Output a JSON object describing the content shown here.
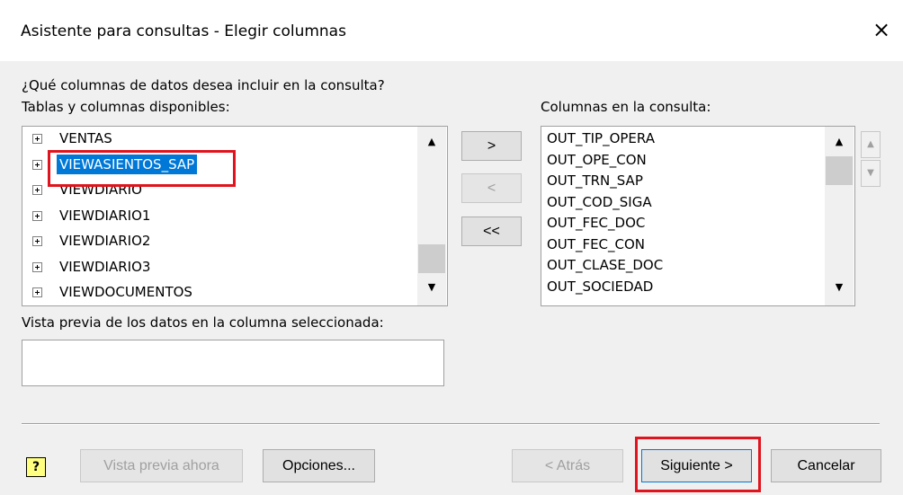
{
  "window": {
    "title": "Asistente para consultas - Elegir columnas",
    "close_icon": "×"
  },
  "question": "¿Qué columnas de datos desea incluir en la consulta?",
  "available": {
    "label": "Tablas y columnas disponibles:",
    "items": [
      {
        "label": "VENTAS"
      },
      {
        "label": "VIEWASIENTOS_SAP",
        "selected": true
      },
      {
        "label": "VIEWDIARIO"
      },
      {
        "label": "VIEWDIARIO1"
      },
      {
        "label": "VIEWDIARIO2"
      },
      {
        "label": "VIEWDIARIO3"
      },
      {
        "label": "VIEWDOCUMENTOS"
      }
    ]
  },
  "move_buttons": {
    "add": ">",
    "remove": "<",
    "remove_all": "<<"
  },
  "query_columns": {
    "label": "Columnas en la consulta:",
    "items": [
      "OUT_TIP_OPERA",
      "OUT_OPE_CON",
      "OUT_TRN_SAP",
      "OUT_COD_SIGA",
      "OUT_FEC_DOC",
      "OUT_FEC_CON",
      "OUT_CLASE_DOC",
      "OUT_SOCIEDAD"
    ]
  },
  "preview": {
    "label": "Vista previa de los datos en la columna seleccionada:",
    "value": ""
  },
  "footer": {
    "help_icon": "?",
    "preview_now": "Vista previa ahora",
    "options": "Opciones...",
    "back": "< Atrás",
    "next": "Siguiente >",
    "cancel": "Cancelar"
  },
  "colors": {
    "selection": "#0078d7",
    "highlight": "#e0141e",
    "background": "#f0f0f0"
  }
}
